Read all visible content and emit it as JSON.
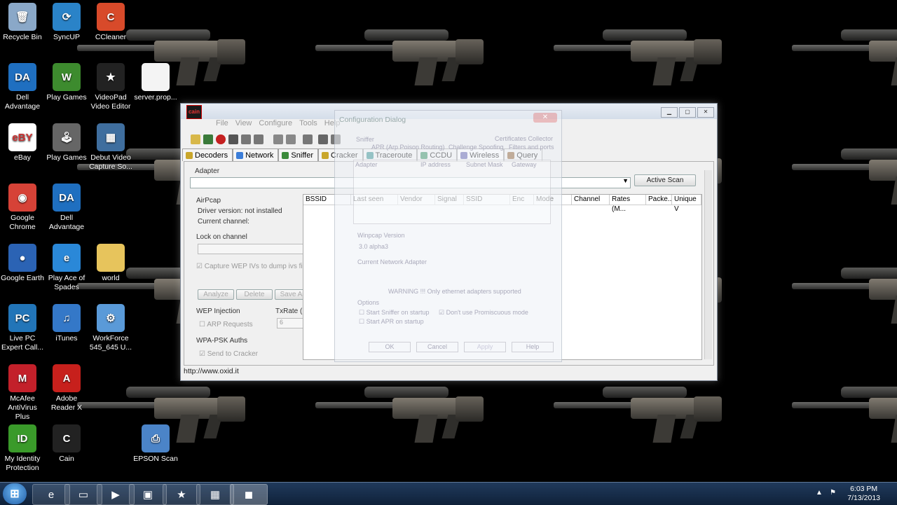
{
  "desktop": {
    "icons": [
      {
        "label": "Recycle Bin",
        "icon": "recycle-bin-icon",
        "color": "#8aa8c8",
        "glyph": "🗑"
      },
      {
        "label": "SyncUP",
        "icon": "syncup-icon",
        "color": "#2a83c8",
        "glyph": "⟳"
      },
      {
        "label": "CCleaner",
        "icon": "ccleaner-icon",
        "color": "#d84a2a",
        "glyph": "C"
      },
      {
        "label": "Dell Advantage",
        "icon": "dell-advantage-icon",
        "color": "#1f6fc0",
        "glyph": "DA"
      },
      {
        "label": "Play Games",
        "icon": "wild-games-icon",
        "color": "#3d8b2e",
        "glyph": "W"
      },
      {
        "label": "VideoPad Video Editor",
        "icon": "videopad-icon",
        "color": "#222222",
        "glyph": "★"
      },
      {
        "label": "server.prop...",
        "icon": "file-icon",
        "color": "#f4f4f4",
        "glyph": ""
      },
      {
        "label": "eBay",
        "icon": "ebay-icon",
        "color": "#ffffff",
        "glyph": "eBY"
      },
      {
        "label": "Play Games",
        "icon": "joystick-icon",
        "color": "#666666",
        "glyph": "🕹"
      },
      {
        "label": "Debut Video Capture So...",
        "icon": "debut-video-icon",
        "color": "#3f6e9e",
        "glyph": "▦"
      },
      {
        "label": "Google Chrome",
        "icon": "chrome-icon",
        "color": "#d64237",
        "glyph": "◉"
      },
      {
        "label": "Dell Advantage",
        "icon": "dell-advantage-icon",
        "color": "#1f6fc0",
        "glyph": "DA"
      },
      {
        "label": "Google Earth",
        "icon": "google-earth-icon",
        "color": "#2b63b4",
        "glyph": "●"
      },
      {
        "label": "Play Ace of Spades",
        "icon": "ie-icon",
        "color": "#2a88d8",
        "glyph": "e"
      },
      {
        "label": "world",
        "icon": "folder-icon",
        "color": "#e7c45c",
        "glyph": ""
      },
      {
        "label": "Live PC Expert Call...",
        "icon": "live-pc-icon",
        "color": "#2275b8",
        "glyph": "PC"
      },
      {
        "label": "iTunes",
        "icon": "itunes-icon",
        "color": "#3478c8",
        "glyph": "♫"
      },
      {
        "label": "WorkForce 545_645 U...",
        "icon": "workforce-icon",
        "color": "#5a9ad8",
        "glyph": "⚙"
      },
      {
        "label": "McAfee AntiVirus Plus",
        "icon": "mcafee-icon",
        "color": "#c3202a",
        "glyph": "M"
      },
      {
        "label": "Adobe Reader X",
        "icon": "adobe-reader-icon",
        "color": "#c7201c",
        "glyph": "A"
      },
      {
        "label": "My Identity Protection",
        "icon": "identity-protection-icon",
        "color": "#3a9a2a",
        "glyph": "ID"
      },
      {
        "label": "Cain",
        "icon": "cain-icon",
        "color": "#222222",
        "glyph": "C"
      },
      {
        "label": "EPSON Scan",
        "icon": "epson-scan-icon",
        "color": "#4b84c8",
        "glyph": "⎙"
      }
    ]
  },
  "app": {
    "menu": [
      "File",
      "View",
      "Configure",
      "Tools",
      "Help"
    ],
    "tabs": [
      {
        "label": "Decoders",
        "color": "#c9a62b"
      },
      {
        "label": "Network",
        "color": "#3b7dd8"
      },
      {
        "label": "Sniffer",
        "color": "#3a8a3a"
      },
      {
        "label": "Cracker",
        "color": "#c9a62b"
      },
      {
        "label": "Traceroute",
        "color": "#2a8a8a"
      },
      {
        "label": "CCDU",
        "color": "#2a8a5a"
      },
      {
        "label": "Wireless",
        "color": "#5a5aaa"
      },
      {
        "label": "Query",
        "color": "#8a5a2a"
      }
    ],
    "active_tab": "Wireless",
    "adapter_label": "Adapter",
    "active_scan": "Active Scan",
    "airpcap": {
      "title": "AirPcap",
      "driver_version": "Driver version: not installed",
      "current_channel": "Current channel:"
    },
    "lock_on_channel": "Lock on channel",
    "capture_wep": "Capture WEP IVs to dump ivs file",
    "buttons": {
      "analyze": "Analyze",
      "delete": "Delete",
      "save_as": "Save As"
    },
    "wep_injection": "WEP Injection",
    "arp_requests": "ARP Requests",
    "txrate": "TxRate (Mbps)",
    "txrate_value": "6",
    "wpa_psk": "WPA-PSK Auths",
    "send_to_cracker": "Send to Cracker",
    "columns": [
      "BSSID",
      "Last seen",
      "Vendor",
      "Signal",
      "SSID",
      "Enc",
      "Mode",
      "Channel",
      "Rates (M...",
      "Packe...",
      "Unique V"
    ],
    "status_url": "http://www.oxid.it"
  },
  "dialog": {
    "title": "Configuration Dialog",
    "tabs_row1": [
      "Sniffer",
      "APR (Arp Poison Routing)",
      "Challenge Spoofing",
      "Filters and ports",
      "Certificates Collector"
    ],
    "columns": [
      "Adapter",
      "IP address",
      "Subnet Mask",
      "Gateway"
    ],
    "winpcap_label": "Winpcap Version",
    "winpcap_value": "3.0 alpha3",
    "current_adapter": "Current Network Adapter",
    "warning": "WARNING !!! Only ethernet adapters supported",
    "options_label": "Options",
    "start_sniffer": "Start Sniffer on startup",
    "start_apr": "Start APR on startup",
    "dont_promiscuous": "Don't use Promiscuous mode",
    "ok": "OK",
    "cancel": "Cancel",
    "apply": "Apply",
    "help": "Help"
  },
  "taskbar": {
    "time": "6:03 PM",
    "date": "7/13/2013"
  }
}
